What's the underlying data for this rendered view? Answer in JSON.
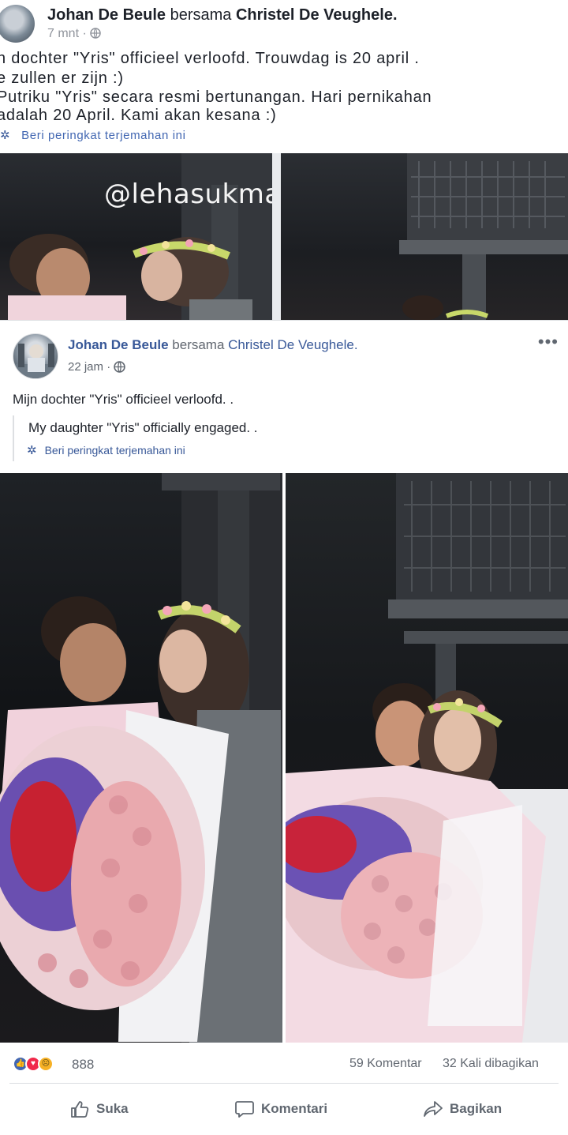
{
  "top_crop": {
    "author": "Johan De Beule",
    "with_word": "bersama",
    "tagged": "Christel De Veughele.",
    "time": "7 mnt",
    "lines": [
      "n dochter \"Yris\" officieel verloofd. Trouwdag is 20 april .",
      "e zullen er zijn :)",
      "Putriku \"Yris\" secara resmi bertunangan. Hari pernikahan",
      "adalah 20 April. Kami akan kesana :)"
    ],
    "rate_link": "Beri peringkat terjemahan ini",
    "watermark": "@lehasukmawati"
  },
  "post": {
    "author": "Johan De Beule",
    "with_word": "bersama",
    "tagged": "Christel De Veughele.",
    "time": "22 jam",
    "original_text": "Mijn dochter \"Yris\" officieel verloofd. .",
    "translated_text": "My daughter \"Yris\" officially engaged. .",
    "rate_link": "Beri peringkat terjemahan ini",
    "more_icon": "more-horizontal-icon",
    "photos": [
      "engagement-photo-left",
      "engagement-photo-right"
    ],
    "reactions": {
      "icons": [
        "like-icon",
        "love-icon",
        "sad-icon"
      ],
      "count": "888"
    },
    "comments_count": "59 Komentar",
    "shares_count": "32 Kali dibagikan",
    "actions": {
      "like": "Suka",
      "comment": "Komentari",
      "share": "Bagikan"
    }
  },
  "colors": {
    "link_blue": "#385898",
    "like_blue": "#4267b2",
    "love_red": "#f0284a",
    "sad_yellow": "#f7b125",
    "meta_gray": "#616770"
  }
}
